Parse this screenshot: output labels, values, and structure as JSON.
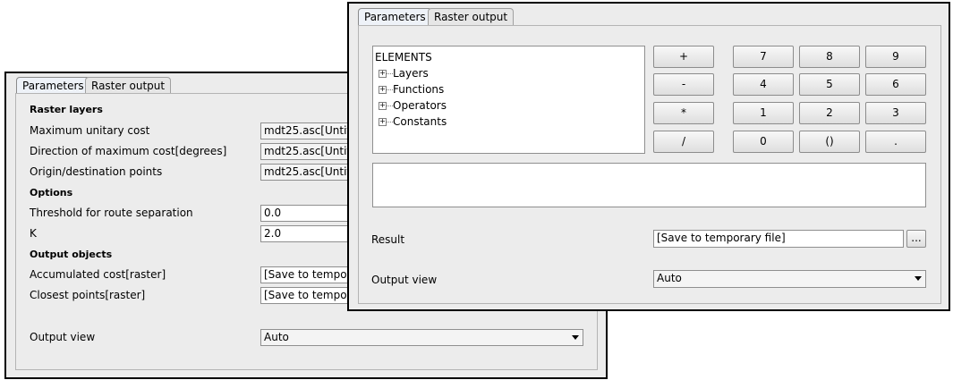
{
  "back_window": {
    "tabs": [
      "Parameters",
      "Raster output"
    ],
    "sections": {
      "raster_layers": "Raster layers",
      "options": "Options",
      "output_objects": "Output objects"
    },
    "rows": {
      "max_unitary_cost": {
        "label": "Maximum unitary cost",
        "value": "mdt25.asc[Untit"
      },
      "direction_max_cost": {
        "label": "Direction of maximum cost[degrees]",
        "value": "mdt25.asc[Untit"
      },
      "origin_destination": {
        "label": "Origin/destination points",
        "value": "mdt25.asc[Untit"
      },
      "threshold": {
        "label": "Threshold for route separation",
        "value": "0.0"
      },
      "k": {
        "label": "K",
        "value": "2.0"
      },
      "accumulated_cost": {
        "label": "Accumulated cost[raster]",
        "value": "[Save to tempora"
      },
      "closest_points": {
        "label": "Closest points[raster]",
        "value": "[Save to tempora"
      }
    },
    "output_view": {
      "label": "Output view",
      "value": "Auto"
    }
  },
  "front_window": {
    "tabs": [
      "Parameters",
      "Raster output"
    ],
    "tree": {
      "root": "ELEMENTS",
      "children": [
        "Layers",
        "Functions",
        "Operators",
        "Constants"
      ]
    },
    "operators": [
      "+",
      "-",
      "*",
      "/"
    ],
    "keypad": [
      "7",
      "8",
      "9",
      "4",
      "5",
      "6",
      "1",
      "2",
      "3",
      "0",
      "()",
      "."
    ],
    "expression": "",
    "result": {
      "label": "Result",
      "value": "[Save to temporary file]",
      "browse": "..."
    },
    "output_view": {
      "label": "Output view",
      "value": "Auto"
    }
  }
}
